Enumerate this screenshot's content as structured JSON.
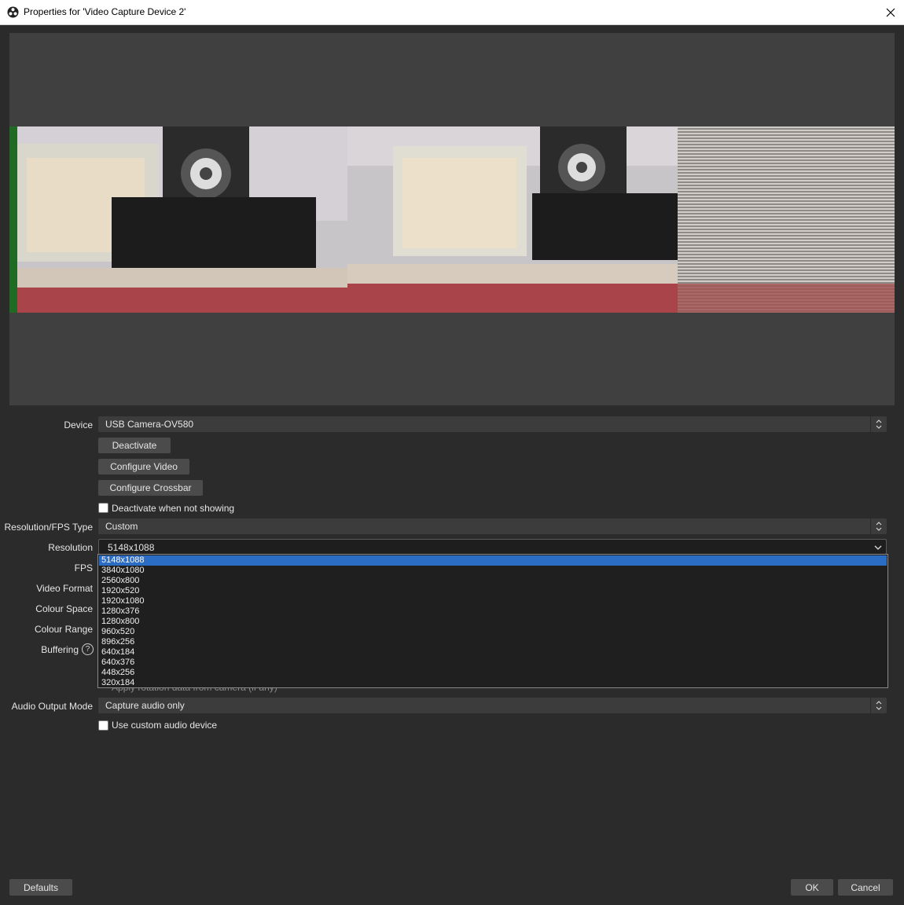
{
  "window": {
    "title": "Properties for 'Video Capture Device 2'"
  },
  "fields": {
    "device_label": "Device",
    "device_value": "USB Camera-OV580",
    "deactivate_button": "Deactivate",
    "configure_video_button": "Configure Video",
    "configure_crossbar_button": "Configure Crossbar",
    "deactivate_when_not_showing": "Deactivate when not showing",
    "res_fps_type_label": "Resolution/FPS Type",
    "res_fps_type_value": "Custom",
    "resolution_label": "Resolution",
    "resolution_value": "5148x1088",
    "fps_label": "FPS",
    "video_format_label": "Video Format",
    "colour_space_label": "Colour Space",
    "colour_range_label": "Colour Range",
    "buffering_label": "Buffering",
    "hidden_checkbox_text": "Apply rotation data from camera (if any)",
    "audio_output_mode_label": "Audio Output Mode",
    "audio_output_mode_value": "Capture audio only",
    "use_custom_audio_device": "Use custom audio device"
  },
  "resolution_options": [
    "5148x1088",
    "3840x1080",
    "2560x800",
    "1920x520",
    "1920x1080",
    "1280x376",
    "1280x800",
    "960x520",
    "896x256",
    "640x184",
    "640x376",
    "448x256",
    "320x184"
  ],
  "selected_resolution_index": 0,
  "footer": {
    "defaults_button": "Defaults",
    "ok_button": "OK",
    "cancel_button": "Cancel"
  },
  "colors": {
    "accent": "#2b6cc4",
    "background": "#2b2b2b",
    "control": "#3c3c3c"
  },
  "icons": {
    "app": "obs-icon",
    "close": "close-icon",
    "help": "help-icon"
  }
}
